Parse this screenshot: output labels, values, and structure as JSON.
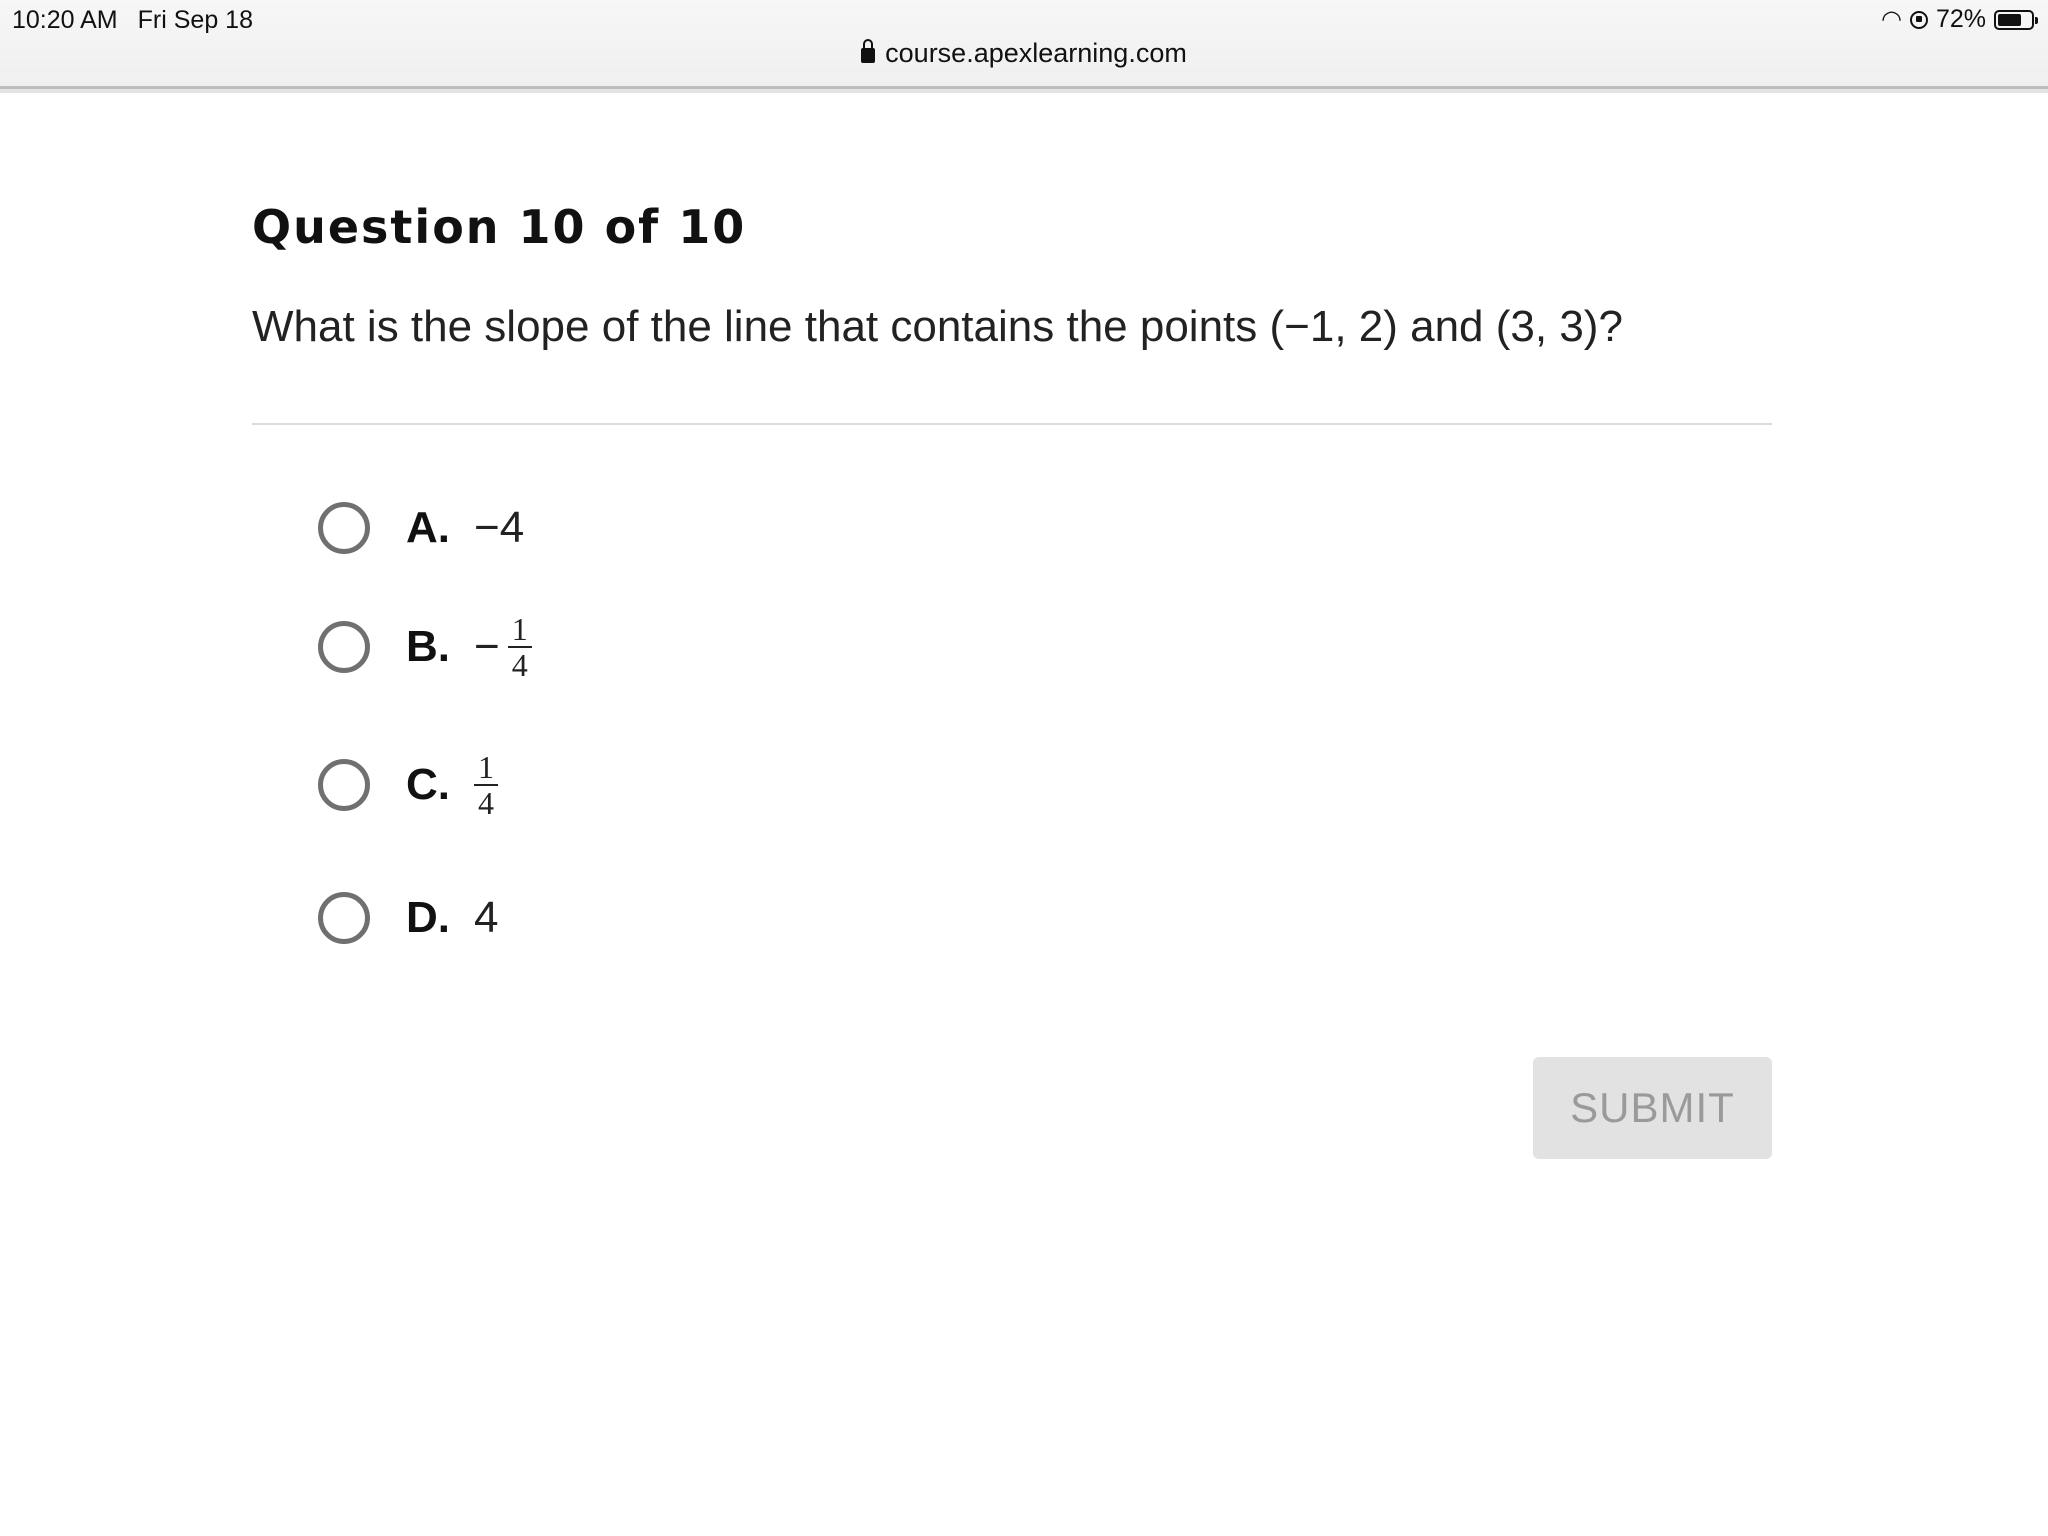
{
  "status_bar": {
    "time": "10:20 AM",
    "date": "Fri Sep 18",
    "url": "course.apexlearning.com",
    "battery": "72%",
    "battery_level": 0.72
  },
  "question": {
    "heading": "Question 10 of 10",
    "text": "What is the slope of the line that contains the points (−1, 2) and (3, 3)?"
  },
  "options": [
    {
      "letter": "A.",
      "value": "−4"
    },
    {
      "letter": "B.",
      "sign": "−",
      "numerator": "1",
      "denominator": "4"
    },
    {
      "letter": "C.",
      "numerator": "1",
      "denominator": "4"
    },
    {
      "letter": "D.",
      "value": "4"
    }
  ],
  "submit_label": "SUBMIT"
}
